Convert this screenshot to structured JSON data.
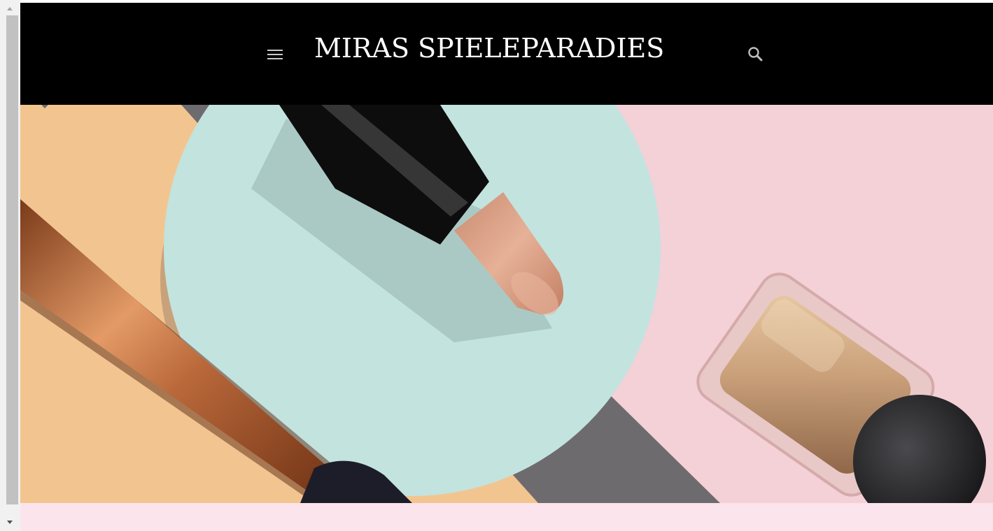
{
  "header": {
    "site_title": "MIRAS SPIELEPARADIES",
    "menu_icon": "hamburger-menu-icon",
    "search_icon": "search-icon",
    "background_color": "#000000",
    "title_color": "#ffffff"
  },
  "hero": {
    "image_description_icon": "cosmetics-hero-image",
    "colors": {
      "pink": "#f4d0d7",
      "peach": "#f2c590",
      "mint": "#c3e3df",
      "gray": "#6e6b6e"
    }
  },
  "content": {
    "background_color": "#fce4ec"
  }
}
